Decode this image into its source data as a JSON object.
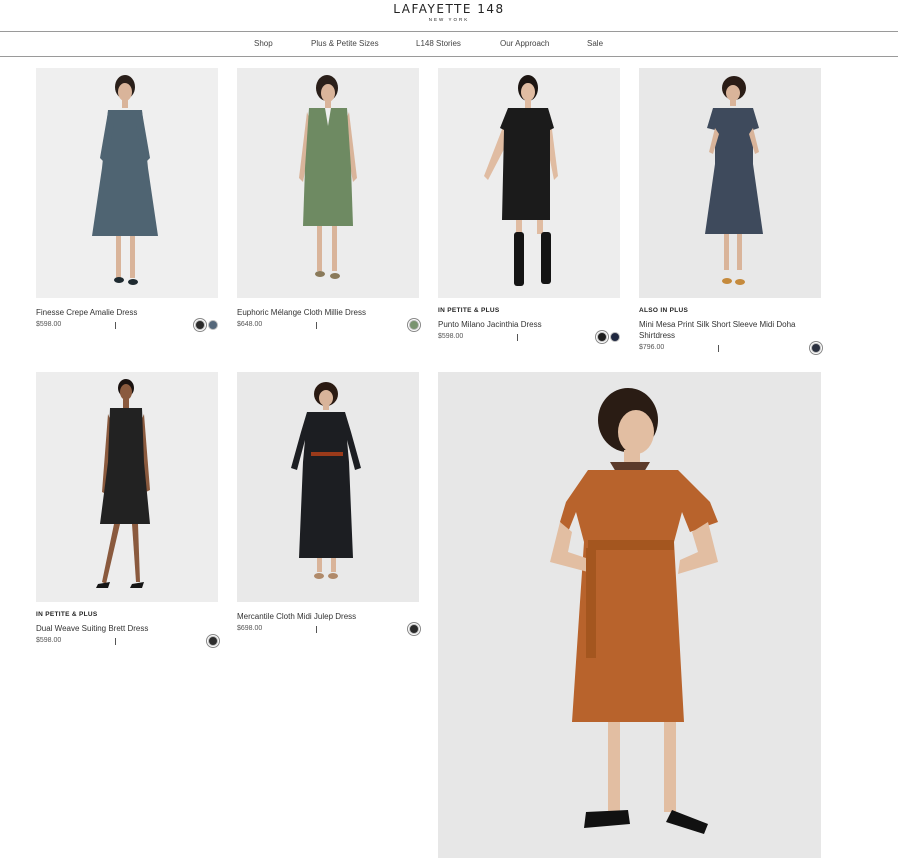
{
  "brand": {
    "name": "LAFAYETTE 148",
    "location": "NEW YORK"
  },
  "nav": [
    "Shop",
    "Plus & Petite Sizes",
    "L148 Stories",
    "Our Approach",
    "Sale"
  ],
  "products": [
    {
      "badge": "",
      "name": "Finesse Crepe Amalie Dress",
      "price": "$598.00",
      "dress_color": "#4f6472",
      "swatches": [
        "#2a2a2a",
        "#55677a"
      ]
    },
    {
      "badge": "",
      "name": "Euphoric Mélange Cloth Millie Dress",
      "price": "$648.00",
      "dress_color": "#6e8a62",
      "swatches": [
        "#7a9470"
      ]
    },
    {
      "badge": "IN PETITE & PLUS",
      "name": "Punto Milano Jacinthia Dress",
      "price": "$598.00",
      "dress_color": "#1b1b1b",
      "swatches": [
        "#1e1e1e",
        "#1f2740"
      ]
    },
    {
      "badge": "ALSO IN PLUS",
      "name": "Mini Mesa Print Silk Short Sleeve Midi Doha Shirtdress",
      "price": "$796.00",
      "dress_color": "#3e4a5c",
      "swatches": [
        "#2b3140"
      ]
    },
    {
      "badge": "IN PETITE & PLUS",
      "name": "Dual Weave Suiting Brett Dress",
      "price": "$598.00",
      "dress_color": "#222222",
      "swatches": [
        "#2e2e2e"
      ]
    },
    {
      "badge": "",
      "name": "Mercantile Cloth Midi Julep Dress",
      "price": "$698.00",
      "dress_color": "#1c1e22",
      "swatches": [
        "#2a2a2a"
      ]
    }
  ],
  "feature": {
    "dress_color": "#b8632c"
  },
  "colors": {
    "photo_bg": "#efefef",
    "divider": "#9a9a9a"
  }
}
